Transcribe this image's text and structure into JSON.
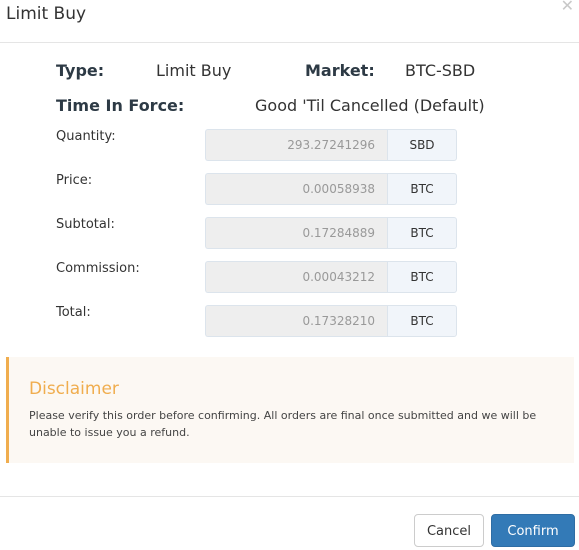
{
  "modal": {
    "title": "Limit Buy",
    "close_icon": "close-icon"
  },
  "summary": {
    "type_label": "Type:",
    "type_value": "Limit Buy",
    "market_label": "Market:",
    "market_value": "BTC-SBD",
    "tif_label": "Time In Force:",
    "tif_value": "Good 'Til Cancelled (Default)"
  },
  "fields": [
    {
      "label": "Quantity:",
      "value": "293.27241296",
      "unit": "SBD"
    },
    {
      "label": "Price:",
      "value": "0.00058938",
      "unit": "BTC"
    },
    {
      "label": "Subtotal:",
      "value": "0.17284889",
      "unit": "BTC"
    },
    {
      "label": "Commission:",
      "value": "0.00043212",
      "unit": "BTC"
    },
    {
      "label": "Total:",
      "value": "0.17328210",
      "unit": "BTC"
    }
  ],
  "disclaimer": {
    "title": "Disclaimer",
    "text": "Please verify this order before confirming. All orders are final once submitted and we will be unable to issue you a refund."
  },
  "footer": {
    "cancel_label": "Cancel",
    "confirm_label": "Confirm"
  },
  "colors": {
    "primary": "#337ab7",
    "warning": "#f0ad4e",
    "disclaimer_bg": "#fcf8f3"
  }
}
